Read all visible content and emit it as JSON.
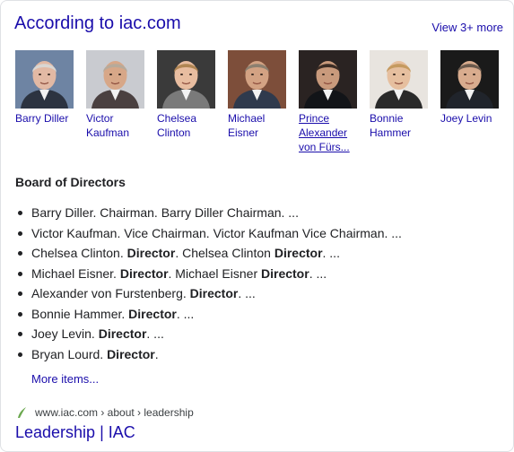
{
  "header": {
    "title": "According to iac.com",
    "view_more": "View 3+ more"
  },
  "people": [
    {
      "name_lines": [
        "Barry Diller"
      ],
      "underlined": false,
      "skin": "#e2b9a4",
      "hair": "#d9d6d2",
      "bg": "#6e84a3",
      "suit": "#2c3340"
    },
    {
      "name_lines": [
        "Victor",
        "Kaufman"
      ],
      "underlined": false,
      "skin": "#d7a788",
      "hair": "#b7aa9a",
      "bg": "#c9cbd0",
      "suit": "#4a4040"
    },
    {
      "name_lines": [
        "Chelsea",
        "Clinton"
      ],
      "underlined": false,
      "skin": "#e8bda0",
      "hair": "#b08654",
      "bg": "#3a3a3a",
      "suit": "#7a7a7a"
    },
    {
      "name_lines": [
        "Michael",
        "Eisner"
      ],
      "underlined": false,
      "skin": "#d3a283",
      "hair": "#8d8070",
      "bg": "#7d4e3a",
      "suit": "#2f3a4d"
    },
    {
      "name_lines": [
        "Prince",
        "Alexander",
        "von Fürs..."
      ],
      "underlined": true,
      "skin": "#c99a7c",
      "hair": "#3b2c24",
      "bg": "#2a2322",
      "suit": "#121418"
    },
    {
      "name_lines": [
        "Bonnie",
        "Hammer"
      ],
      "underlined": false,
      "skin": "#e6bf9f",
      "hair": "#c59a60",
      "bg": "#e8e4df",
      "suit": "#2a2a2a"
    },
    {
      "name_lines": [
        "Joey Levin"
      ],
      "underlined": false,
      "skin": "#d9ac8e",
      "hair": "#6b5a4d",
      "bg": "#1a1a1a",
      "suit": "#20242b"
    }
  ],
  "section": {
    "heading": "Board of Directors"
  },
  "board": [
    {
      "name": "Barry Diller",
      "role": "Chairman",
      "repeat": "Barry Diller Chairman"
    },
    {
      "name": "Victor Kaufman",
      "role": "Vice Chairman",
      "repeat": "Victor Kaufman Vice Chairman"
    },
    {
      "name": "Chelsea Clinton",
      "role": "Director",
      "repeat_name": "Chelsea Clinton",
      "repeat_role": "Director"
    },
    {
      "name": "Michael Eisner",
      "role": "Director",
      "repeat_name": "Michael Eisner",
      "repeat_role": "Director"
    },
    {
      "name": "Alexander von Furstenberg",
      "role": "Director"
    },
    {
      "name": "Bonnie Hammer",
      "role": "Director"
    },
    {
      "name": "Joey Levin",
      "role": "Director"
    },
    {
      "name": "Bryan Lourd",
      "role": "Director"
    }
  ],
  "bullets_text": [
    [
      "Barry Diller. Chairman. Barry Diller Chairman. ..."
    ],
    [
      "Victor Kaufman. Vice Chairman. Victor Kaufman Vice Chairman. ..."
    ],
    [
      "Chelsea Clinton. ",
      "Director",
      ". Chelsea Clinton ",
      "Director",
      ". ..."
    ],
    [
      "Michael Eisner. ",
      "Director",
      ". Michael Eisner ",
      "Director",
      ". ..."
    ],
    [
      "Alexander von Furstenberg. ",
      "Director",
      ". ..."
    ],
    [
      "Bonnie Hammer. ",
      "Director",
      ". ..."
    ],
    [
      "Joey Levin. ",
      "Director",
      ". ..."
    ],
    [
      "Bryan Lourd. ",
      "Director",
      "."
    ]
  ],
  "more_items": "More items...",
  "source": {
    "breadcrumb": "www.iac.com › about › leadership",
    "title": "Leadership | IAC"
  }
}
